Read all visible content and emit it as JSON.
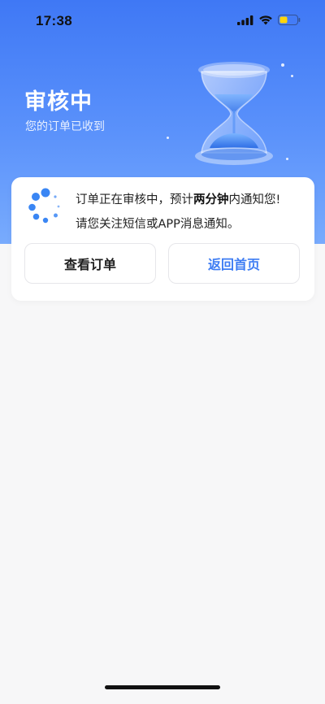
{
  "status_bar": {
    "time": "17:38"
  },
  "hero": {
    "title": "审核中",
    "subtitle": "您的订单已收到",
    "bg_colors": [
      "#3f78f5",
      "#78abfd"
    ]
  },
  "card": {
    "message_prefix": "订单正在审核中，预计",
    "message_highlight": "两分钟",
    "message_suffix": "内通知您!",
    "message_line2": "请您关注短信或APP消息通知。",
    "icon": "loading-spinner-icon"
  },
  "buttons": {
    "view_order": "查看订单",
    "back_home": "返回首页"
  },
  "colors": {
    "accent": "#3d7cf3",
    "spinner": "#3a86f4"
  }
}
